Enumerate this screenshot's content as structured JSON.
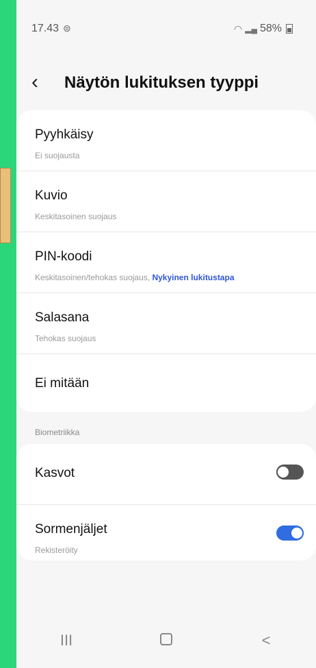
{
  "status_bar": {
    "time": "17.43",
    "time_icon": "⊜",
    "battery_text": "58%"
  },
  "header": {
    "title": "Näytön lukituksen tyyppi"
  },
  "options": [
    {
      "label": "Pyyhkäisy",
      "sub": "Ei suojausta"
    },
    {
      "label": "Kuvio",
      "sub": "Keskitasoinen suojaus"
    },
    {
      "label": "PIN-koodi",
      "sub": "Keskitasoinen/tehokas suojaus,",
      "sub_accent": "Nykyinen lukitustapa"
    },
    {
      "label": "Salasana",
      "sub": "Tehokas suojaus"
    },
    {
      "label": "Ei mitään"
    }
  ],
  "biometrics": {
    "section_title": "Biometriikka",
    "items": [
      {
        "label": "Kasvot",
        "toggle": "off"
      },
      {
        "label": "Sormenjäljet",
        "sub": "Rekisteröity",
        "toggle": "on"
      }
    ]
  },
  "colors": {
    "accent": "#2f55d4",
    "toggle_on": "#2f6de0",
    "background_frame": "#2bd67b"
  },
  "nav": {
    "recents": "III",
    "back": "<"
  }
}
